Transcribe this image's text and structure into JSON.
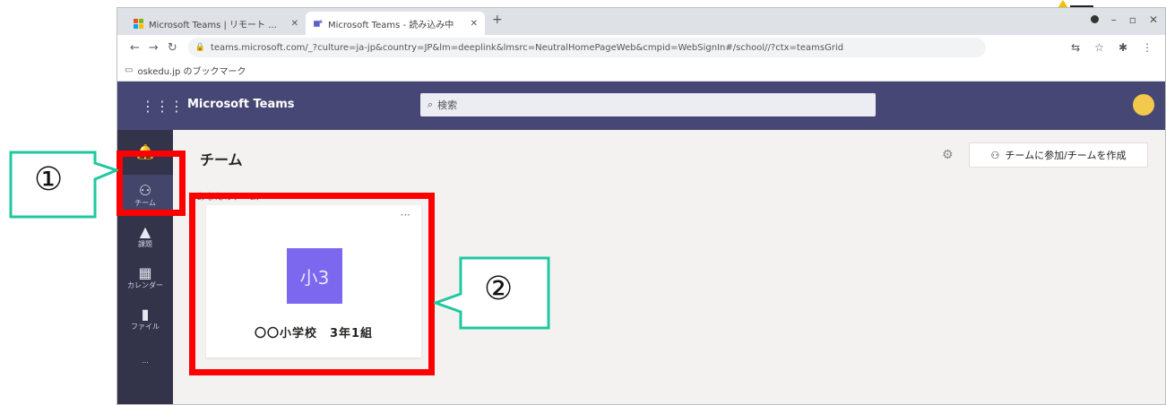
{
  "browser": {
    "tabs": [
      {
        "title": "Microsoft Teams | リモート ... ",
        "active": false
      },
      {
        "title": "Microsoft Teams - 読み込み中",
        "active": true
      }
    ],
    "new_tab_label": "+",
    "url": "teams.microsoft.com/_?culture=ja-jp&country=JP&lm=deeplink&lmsrc=NeutralHomePageWeb&cmpid=WebSignIn#/school//?ctx=teamsGrid",
    "bookmark_folder": "oskedu.jp のブックマーク"
  },
  "teams": {
    "app_title": "Microsoft Teams",
    "search_placeholder": "検索",
    "avatar_initial": "",
    "rail": [
      {
        "label": "",
        "icon": "bell-icon",
        "active": false
      },
      {
        "label": "チーム",
        "icon": "teams-icon",
        "active": true
      },
      {
        "label": "課題",
        "icon": "assignments-icon",
        "active": false
      },
      {
        "label": "カレンダー",
        "icon": "calendar-icon",
        "active": false
      },
      {
        "label": "ファイル",
        "icon": "files-icon",
        "active": false
      },
      {
        "label": "...",
        "icon": "more-icon",
        "active": false
      }
    ],
    "page_title": "チーム",
    "join_button": "チームに参加/チームを作成",
    "section_label": "▾ あなたのチーム",
    "team_card": {
      "tile_text": "小3",
      "name": "〇〇小学校　3年1組",
      "tile_color": "#7b68ee",
      "more": "···"
    }
  },
  "annotations": {
    "callout1": "①",
    "callout2": "②",
    "highlight_color": "#ff0000",
    "callout_border_color": "#1fc8a0"
  }
}
